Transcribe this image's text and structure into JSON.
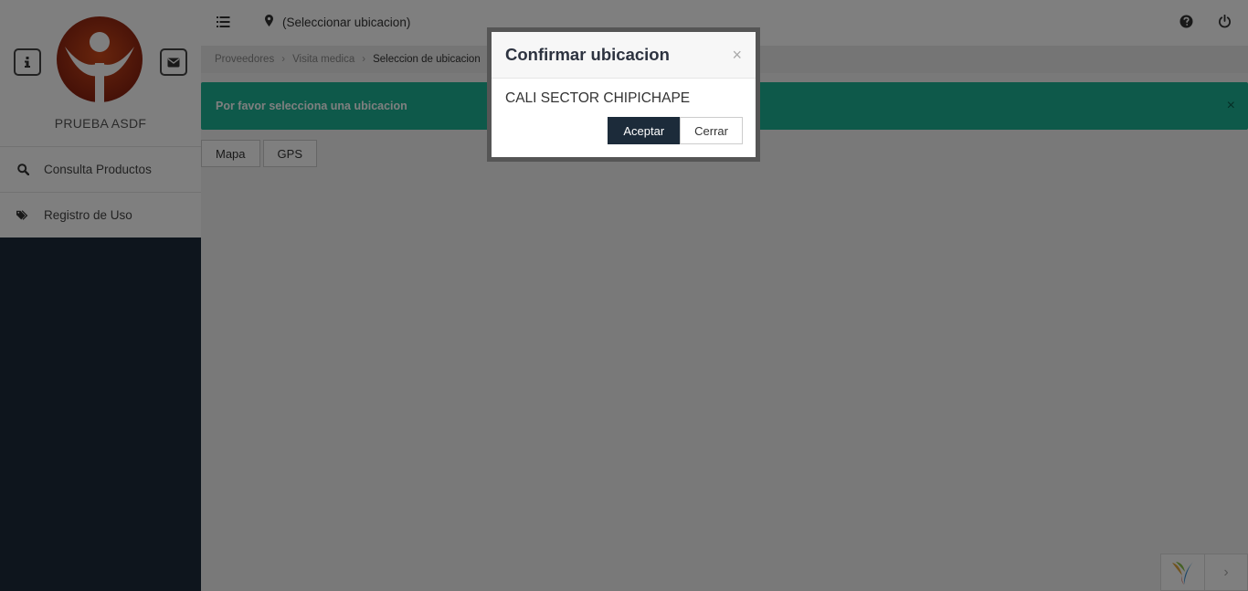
{
  "sidebar": {
    "profile_name": "PRUEBA ASDF",
    "items": [
      {
        "label": "Consulta Productos",
        "icon": "search-icon"
      },
      {
        "label": "Registro de Uso",
        "icon": "tags-icon"
      }
    ]
  },
  "topbar": {
    "location": "(Seleccionar ubicacion)"
  },
  "breadcrumb": [
    "Proveedores",
    "Visita medica",
    "Seleccion de ubicacion"
  ],
  "alert": {
    "message": "Por favor selecciona una ubicacion",
    "close": "×"
  },
  "tabs": [
    "Mapa",
    "GPS"
  ],
  "modal": {
    "title": "Confirmar ubicacion",
    "close": "×",
    "text": "CALI SECTOR CHIPICHAPE",
    "accept_label": "Aceptar",
    "close_label": "Cerrar"
  },
  "debug_toolbar": {
    "toggle": "›"
  },
  "colors": {
    "sidebar_bg": "#1c2b3a",
    "alert_bg": "#1db394",
    "accept_btn": "#1c2b3a"
  }
}
